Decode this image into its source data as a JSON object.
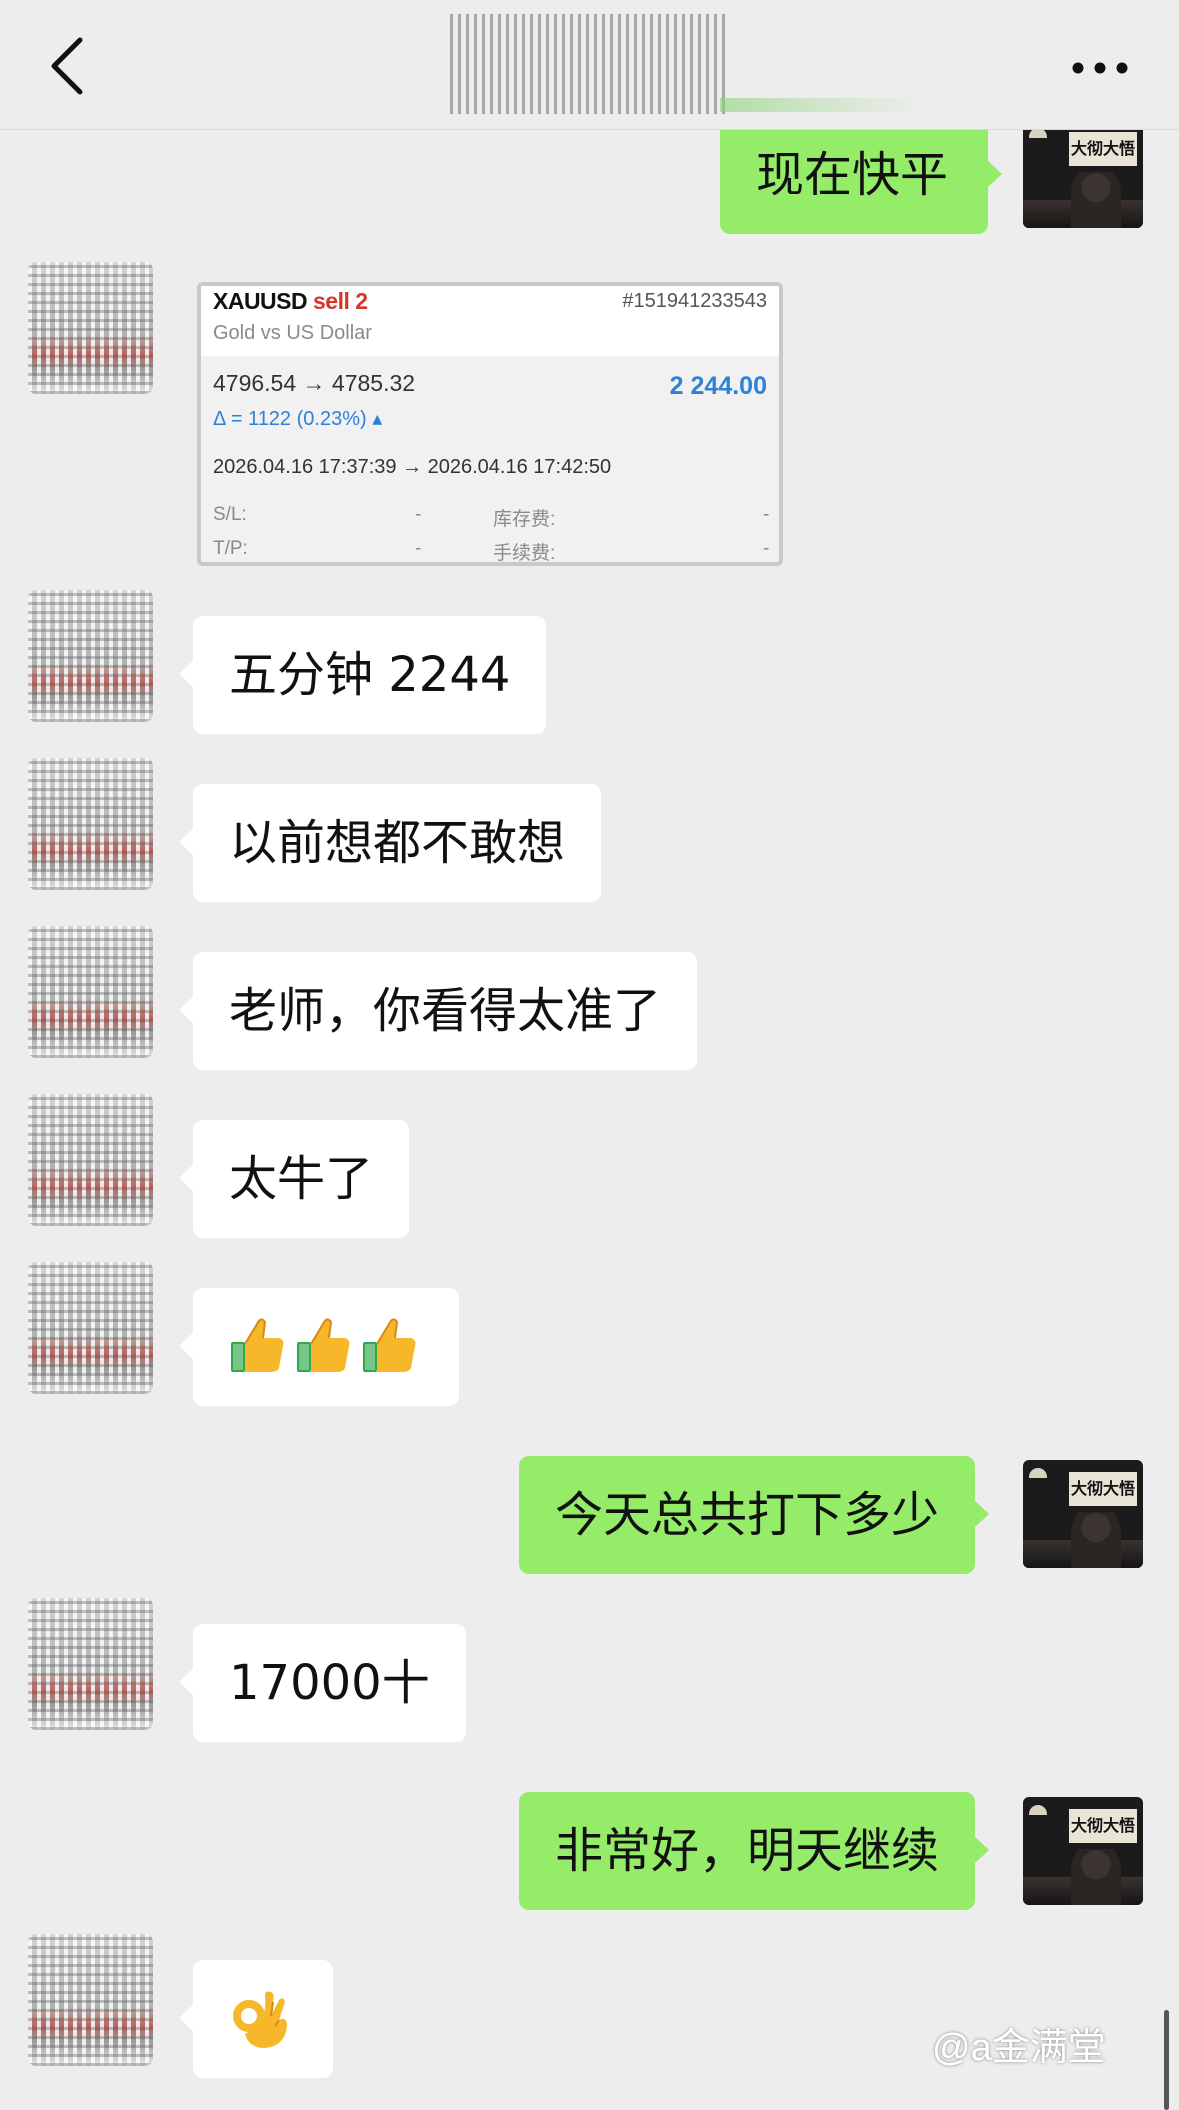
{
  "header": {
    "back_icon": "chevron-left-icon",
    "more_icon": "more-dots-icon"
  },
  "messages": {
    "m1": {
      "side": "self",
      "text": "现在快平"
    },
    "trade_card": {
      "symbol": "XAUUSD",
      "side_label": "sell 2",
      "ticket": "#151941233543",
      "description": "Gold vs US Dollar",
      "prices": "4796.54 → 4785.32",
      "profit": "2 244.00",
      "delta": "Δ = 1122 (0.23%) ▴",
      "times": "2026.04.16 17:37:39 → 2026.04.16 17:42:50",
      "sl_label": "S/L:",
      "sl_value": "-",
      "tp_label": "T/P:",
      "tp_value": "-",
      "swap_label": "库存费:",
      "swap_value": "-",
      "commission_label": "手续费:",
      "commission_value": "-"
    },
    "m2": {
      "side": "other",
      "text": "五分钟 2244"
    },
    "m3": {
      "side": "other",
      "text": "以前想都不敢想"
    },
    "m4": {
      "side": "other",
      "text": "老师，你看得太准了"
    },
    "m5": {
      "side": "other",
      "text": "太牛了"
    },
    "m6": {
      "side": "other",
      "emoji": "thumbs-up ×3"
    },
    "m7": {
      "side": "self",
      "text": "今天总共打下多少"
    },
    "m8": {
      "side": "other",
      "text": "17000十"
    },
    "m9": {
      "side": "self",
      "text": "非常好，明天继续"
    },
    "m10": {
      "side": "other",
      "emoji": "ok-hand"
    }
  },
  "self_avatar_sign": "大彻大悟",
  "watermark": "@a金满堂",
  "colors": {
    "background": "#ededed",
    "self_bubble": "#95ec69",
    "other_bubble": "#ffffff",
    "profit_blue": "#2f80d8",
    "sell_red": "#d9342b"
  }
}
